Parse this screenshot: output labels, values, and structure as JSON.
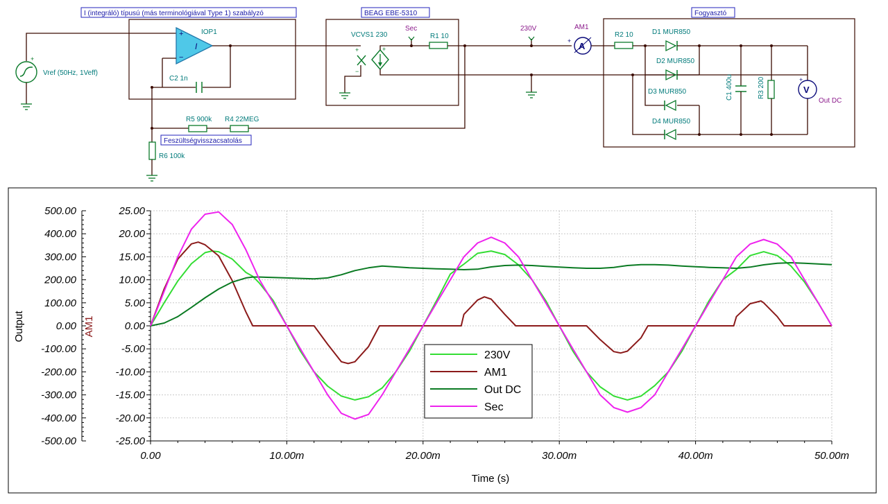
{
  "schematic": {
    "titles": {
      "controller": "I (integráló) típusú (más terminológiával Type 1) szabályzó",
      "source_block": "BEAG EBE-5310",
      "load": "Fogyasztó",
      "feedback": "Feszültségvisszacsatolás"
    },
    "components": {
      "vref": "Vref (50Hz, 1Veff)",
      "iop1": "IOP1",
      "c2": "C2 1n",
      "r5": "R5 900k",
      "r4": "R4 22MEG",
      "r6": "R6 100k",
      "vcvs1": "VCVS1 230",
      "sec": "Sec",
      "r1": "R1 10",
      "node230": "230V",
      "am1": "AM1",
      "r2": "R2 10",
      "d1": "D1 MUR850",
      "d2": "D2 MUR850",
      "d3": "D3 MUR850",
      "d4": "D4 MUR850",
      "c1": "C1 400u",
      "r3": "R3 200",
      "outdc": "Out DC",
      "integrator_symbol": "I",
      "ammeter_symbol": "A",
      "voltmeter_symbol": "V"
    }
  },
  "chart_data": {
    "type": "line",
    "xlabel": "Time (s)",
    "ylabel_left": "Output",
    "ylabel_right": "AM1",
    "xlim": [
      0,
      0.05
    ],
    "ylim_left": [
      -500,
      500
    ],
    "ylim_right": [
      -25,
      25
    ],
    "x_ticks": [
      "0.00",
      "10.00m",
      "20.00m",
      "30.00m",
      "40.00m",
      "50.00m"
    ],
    "y_ticks_left": [
      "500.00",
      "400.00",
      "300.00",
      "200.00",
      "100.00",
      "0.00",
      "-100.00",
      "-200.00",
      "-300.00",
      "-400.00",
      "-500.00"
    ],
    "y_ticks_right": [
      "25.00",
      "20.00",
      "15.00",
      "10.00",
      "5.00",
      "0.00",
      "-5.00",
      "-10.00",
      "-15.00",
      "-20.00",
      "-25.00"
    ],
    "grid": true,
    "legend_position": "bottom-center",
    "series": [
      {
        "name": "230V",
        "color": "#33dd33",
        "axis": "left",
        "x": [
          0,
          0.001,
          0.002,
          0.003,
          0.004,
          0.0045,
          0.005,
          0.006,
          0.007,
          0.0075,
          0.008,
          0.009,
          0.01,
          0.011,
          0.012,
          0.013,
          0.014,
          0.015,
          0.016,
          0.017,
          0.018,
          0.019,
          0.02,
          0.021,
          0.022,
          0.023,
          0.024,
          0.025,
          0.026,
          0.027,
          0.028,
          0.029,
          0.03,
          0.031,
          0.032,
          0.033,
          0.034,
          0.035,
          0.036,
          0.037,
          0.038,
          0.039,
          0.04,
          0.041,
          0.042,
          0.043,
          0.044,
          0.045,
          0.046,
          0.047,
          0.048,
          0.049,
          0.05
        ],
        "y": [
          0,
          100,
          195,
          270,
          318,
          325,
          322,
          290,
          232,
          215,
          185,
          110,
          0,
          -110,
          -200,
          -262,
          -305,
          -322,
          -308,
          -270,
          -200,
          -110,
          0,
          110,
          225,
          268,
          315,
          325,
          310,
          265,
          200,
          110,
          0,
          -110,
          -200,
          -265,
          -305,
          -322,
          -305,
          -260,
          -200,
          -110,
          0,
          110,
          200,
          245,
          305,
          322,
          305,
          260,
          190,
          100,
          0
        ]
      },
      {
        "name": "AM1",
        "color": "#8b1a1a",
        "axis": "right",
        "x": [
          0,
          0.001,
          0.002,
          0.003,
          0.0035,
          0.004,
          0.005,
          0.006,
          0.007,
          0.0075,
          0.008,
          0.012,
          0.013,
          0.014,
          0.0145,
          0.015,
          0.016,
          0.0168,
          0.0172,
          0.0228,
          0.023,
          0.024,
          0.0245,
          0.025,
          0.026,
          0.0268,
          0.032,
          0.033,
          0.034,
          0.0345,
          0.035,
          0.036,
          0.0365,
          0.0428,
          0.043,
          0.044,
          0.0448,
          0.045,
          0.046,
          0.0465,
          0.05
        ],
        "y": [
          0,
          8,
          14.5,
          17.8,
          18.2,
          17.6,
          15.2,
          9.8,
          3,
          0,
          0,
          0,
          -4,
          -7.8,
          -8.2,
          -7.8,
          -4.5,
          0,
          0,
          0,
          2.5,
          5.6,
          6.3,
          5.8,
          2.5,
          0,
          0,
          -3,
          -5.6,
          -5.9,
          -5.5,
          -2.6,
          0,
          0,
          2,
          4.8,
          5.4,
          5.0,
          2,
          0,
          0
        ]
      },
      {
        "name": "Out DC",
        "color": "#0a7a22",
        "axis": "left",
        "x": [
          0,
          0.001,
          0.002,
          0.003,
          0.004,
          0.005,
          0.006,
          0.007,
          0.0075,
          0.008,
          0.009,
          0.01,
          0.011,
          0.012,
          0.013,
          0.014,
          0.015,
          0.016,
          0.017,
          0.018,
          0.019,
          0.02,
          0.021,
          0.022,
          0.023,
          0.024,
          0.025,
          0.026,
          0.027,
          0.028,
          0.029,
          0.03,
          0.031,
          0.032,
          0.033,
          0.034,
          0.035,
          0.036,
          0.037,
          0.038,
          0.039,
          0.04,
          0.041,
          0.042,
          0.043,
          0.044,
          0.045,
          0.046,
          0.047,
          0.048,
          0.049,
          0.05
        ],
        "y": [
          0,
          12,
          40,
          80,
          122,
          160,
          190,
          208,
          212,
          212,
          210,
          208,
          206,
          204,
          208,
          222,
          240,
          252,
          260,
          256,
          252,
          250,
          248,
          246,
          244,
          246,
          256,
          262,
          264,
          262,
          258,
          255,
          252,
          250,
          250,
          254,
          262,
          266,
          266,
          264,
          260,
          257,
          254,
          252,
          250,
          255,
          265,
          272,
          274,
          272,
          269,
          266
        ]
      },
      {
        "name": "Sec",
        "color": "#ee22ee",
        "axis": "left",
        "x": [
          0,
          0.001,
          0.002,
          0.003,
          0.004,
          0.005,
          0.006,
          0.007,
          0.008,
          0.009,
          0.01,
          0.011,
          0.012,
          0.013,
          0.014,
          0.015,
          0.016,
          0.017,
          0.018,
          0.019,
          0.02,
          0.021,
          0.022,
          0.023,
          0.024,
          0.025,
          0.026,
          0.027,
          0.028,
          0.029,
          0.03,
          0.031,
          0.032,
          0.033,
          0.034,
          0.035,
          0.036,
          0.037,
          0.038,
          0.039,
          0.04,
          0.041,
          0.042,
          0.043,
          0.044,
          0.045,
          0.046,
          0.047,
          0.048,
          0.049,
          0.05
        ],
        "y": [
          0,
          150,
          300,
          420,
          485,
          495,
          440,
          330,
          200,
          100,
          0,
          -100,
          -200,
          -300,
          -380,
          -405,
          -385,
          -300,
          -200,
          -100,
          0,
          100,
          200,
          300,
          360,
          385,
          360,
          300,
          200,
          100,
          0,
          -100,
          -200,
          -300,
          -355,
          -375,
          -355,
          -300,
          -200,
          -100,
          0,
          100,
          200,
          300,
          355,
          375,
          355,
          300,
          200,
          100,
          0
        ]
      }
    ]
  }
}
